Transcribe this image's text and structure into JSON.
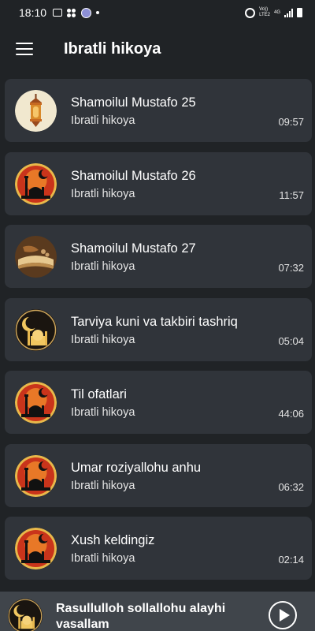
{
  "status_bar": {
    "time": "18:10",
    "network_top": "Vo))",
    "network_bottom": "LTE2",
    "network_type": "4G",
    "left_icons": [
      "gallery-icon",
      "app-dots-icon",
      "app-circle-icon",
      "dot-icon"
    ],
    "right_icons": [
      "hotspot-icon",
      "signal-icon",
      "battery-icon"
    ]
  },
  "app_bar": {
    "title": "Ibratli hikoya",
    "menu_icon": "hamburger-menu-icon"
  },
  "tracks": [
    {
      "title": "Shamoilul Mustafo 25",
      "subtitle": "Ibratli hikoya",
      "duration": "09:57",
      "thumb": "lantern"
    },
    {
      "title": "Shamoilul Mustafo 26",
      "subtitle": "Ibratli hikoya",
      "duration": "11:57",
      "thumb": "mosque-red"
    },
    {
      "title": "Shamoilul Mustafo 27",
      "subtitle": "Ibratli hikoya",
      "duration": "07:32",
      "thumb": "quran"
    },
    {
      "title": "Tarviya kuni va takbiri tashriq",
      "subtitle": "Ibratli hikoya",
      "duration": "05:04",
      "thumb": "crescent"
    },
    {
      "title": "Til ofatlari",
      "subtitle": "Ibratli hikoya",
      "duration": "44:06",
      "thumb": "mosque-red"
    },
    {
      "title": "Umar roziyallohu anhu",
      "subtitle": "Ibratli hikoya",
      "duration": "06:32",
      "thumb": "mosque-red"
    },
    {
      "title": "Xush keldingiz",
      "subtitle": "Ibratli hikoya",
      "duration": "02:14",
      "thumb": "mosque-red"
    }
  ],
  "now_playing": {
    "title": "Rasullulloh sollallohu alayhi vasallam",
    "thumb": "mosque-gold",
    "play_icon": "play-icon"
  },
  "colors": {
    "background": "#202326",
    "card": "#30343a",
    "player": "#40454b",
    "text": "#ffffff"
  }
}
